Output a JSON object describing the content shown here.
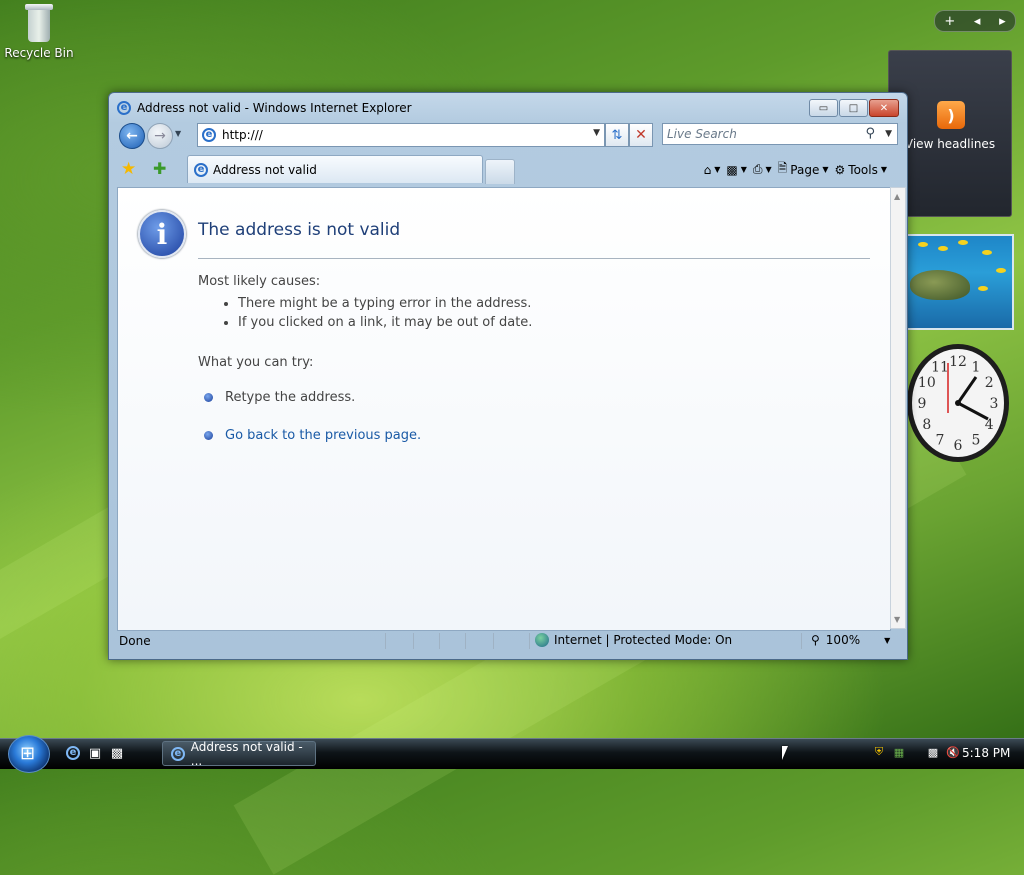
{
  "desktop": {
    "recycle_bin_label": "Recycle Bin"
  },
  "sidebar": {
    "controls": {
      "add": "+",
      "prev": "◂",
      "next": "▸"
    },
    "feed_gadget_label": "View headlines",
    "clock_numbers": [
      "12",
      "1",
      "2",
      "3",
      "4",
      "5",
      "6",
      "7",
      "8",
      "9",
      "10",
      "11"
    ]
  },
  "window": {
    "title": "Address not valid - Windows Internet Explorer",
    "minimize": "▭",
    "maximize": "□",
    "close": "✕",
    "address": "http:///",
    "search_placeholder": "Live Search",
    "tab_title": "Address not valid",
    "commands": {
      "page": "Page",
      "tools": "Tools"
    }
  },
  "page": {
    "title": "The address is not valid",
    "causes_heading": "Most likely causes:",
    "causes": [
      "There might be a typing error in the address.",
      "If you clicked on a link, it may be out of date."
    ],
    "try_heading": "What you can try:",
    "retype": "Retype the address.",
    "go_back": "Go back to the previous page."
  },
  "status": {
    "text": "Done",
    "zone": "Internet | Protected Mode: On",
    "zoom": "100%"
  },
  "taskbar": {
    "window_button": "Address not valid - ...",
    "time": "5:18 PM"
  },
  "colors": {
    "link": "#1a5aa6",
    "title_blue": "#1f3f78"
  }
}
